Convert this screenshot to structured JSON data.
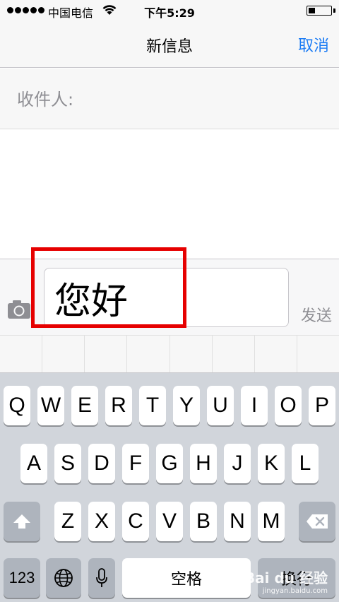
{
  "status_bar": {
    "carrier": "中国电信",
    "time": "下午5:29",
    "battery_level": 0.3
  },
  "nav": {
    "title": "新信息",
    "cancel_label": "取消"
  },
  "recipient": {
    "label": "收件人:",
    "value": ""
  },
  "compose": {
    "message_text": "您好",
    "send_label": "发送"
  },
  "keyboard": {
    "row1": [
      "Q",
      "W",
      "E",
      "R",
      "T",
      "Y",
      "U",
      "I",
      "O",
      "P"
    ],
    "row2": [
      "A",
      "S",
      "D",
      "F",
      "G",
      "H",
      "J",
      "K",
      "L"
    ],
    "row3": [
      "Z",
      "X",
      "C",
      "V",
      "B",
      "N",
      "M"
    ],
    "numbers_label": "123",
    "space_label": "空格",
    "return_label": "换行"
  },
  "watermark": {
    "main": "Bai du 经验",
    "sub": "jingyan.baidu.com"
  },
  "colors": {
    "accent": "#1c7cf4",
    "highlight": "#e60000"
  }
}
